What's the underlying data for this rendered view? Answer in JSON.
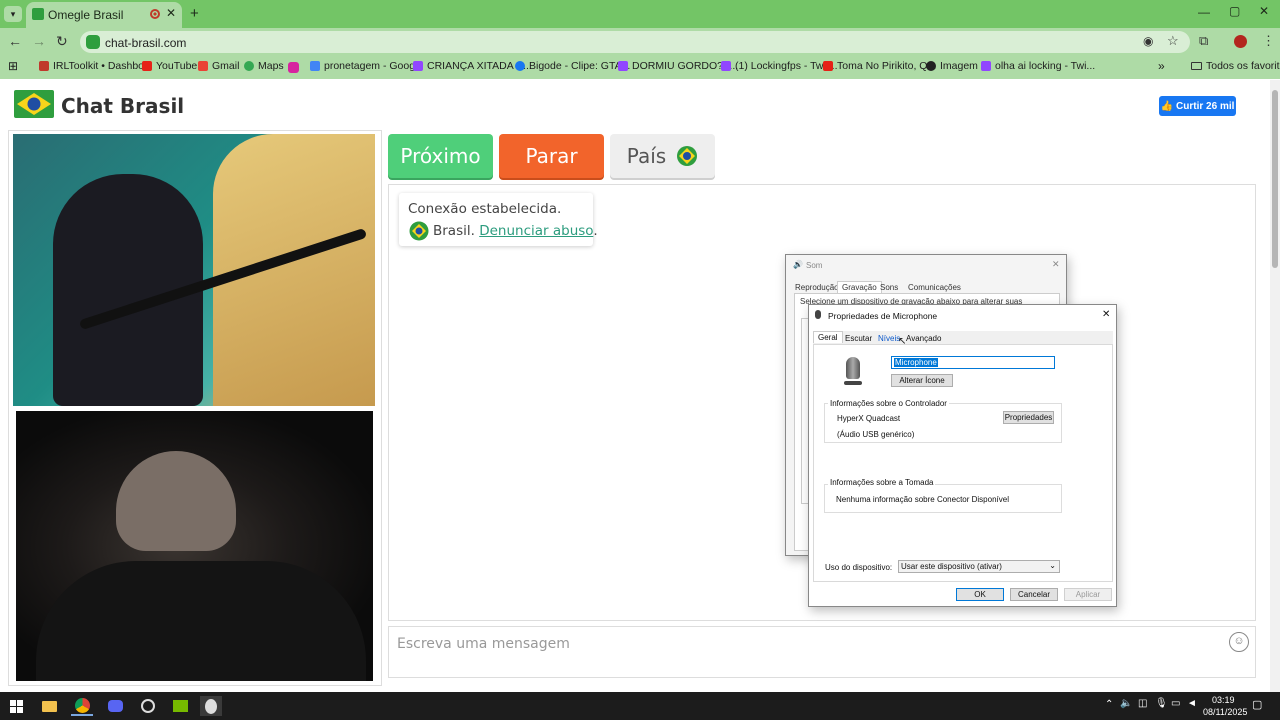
{
  "browser": {
    "tab_title": "Omegle Brasil",
    "url": "chat-brasil.com",
    "bookmarks": [
      {
        "label": "IRLToolkit • Dashbo...",
        "color": "#c0392b"
      },
      {
        "label": "YouTube",
        "color": "#e62117"
      },
      {
        "label": "Gmail",
        "color": "#ea4335"
      },
      {
        "label": "Maps",
        "color": "#34a853"
      },
      {
        "label": "pronetagem - Goog...",
        "color": "#4285f4"
      },
      {
        "label": "CRIANÇA XITADA K...",
        "color": "#9146ff"
      },
      {
        "label": "Bigode - Clipe: GTA...",
        "color": "#1877f2"
      },
      {
        "label": "DORMIU GORDO? -...",
        "color": "#9146ff"
      },
      {
        "label": "(1) Lockingfps - Twit...",
        "color": "#9146ff"
      },
      {
        "label": "Toma No Pirikito, Q...",
        "color": "#e62117"
      },
      {
        "label": "Imagem",
        "color": "#222222"
      },
      {
        "label": "olha ai locking - Twi...",
        "color": "#9146ff"
      }
    ],
    "all_bookmarks": "Todos os favoritos"
  },
  "site": {
    "logo": "Chat Brasil",
    "like_button": "Curtir 26 mil",
    "next_button": "Próximo",
    "stop_button": "Parar",
    "country_button": "País",
    "status_line": "Conexão estabelecida.",
    "country_name": "Brasil.",
    "report_link": "Denunciar abuso",
    "report_suffix": ".",
    "message_placeholder": "Escreva uma mensagem"
  },
  "sound_dialog": {
    "title": "Som",
    "tabs": [
      "Reprodução",
      "Gravação",
      "Sons",
      "Comunicações"
    ],
    "instruction": "Selecione um dispositivo de gravação abaixo para alterar suas"
  },
  "mic_dialog": {
    "title": "Propriedades de Microphone",
    "tabs": [
      "Geral",
      "Escutar",
      "Níveis",
      "Avançado"
    ],
    "name_value": "Microphone",
    "change_icon": "Alterar Ícone",
    "controller_group": "Informações sobre o Controlador",
    "controller_name": "HyperX Quadcast",
    "controller_sub": "(Áudio USB genérico)",
    "properties_button": "Propriedades",
    "jack_group": "Informações sobre a Tomada",
    "jack_info": "Nenhuma informação sobre Conector Disponível",
    "usage_label": "Uso do dispositivo:",
    "usage_value": "Usar este dispositivo (ativar)",
    "ok": "OK",
    "cancel": "Cancelar",
    "apply": "Aplicar"
  },
  "taskbar": {
    "time": "03:19",
    "date": "08/11/2025"
  }
}
